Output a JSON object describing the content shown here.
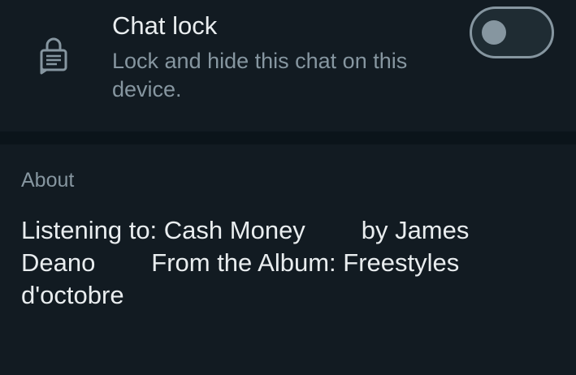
{
  "chat_lock": {
    "icon": "lock-chat-icon",
    "title": "Chat lock",
    "description": "Lock and hide this chat on this device.",
    "toggle_on": false
  },
  "about": {
    "heading": "About",
    "text": "Listening to: Cash Money        by James Deano        From the Album: Freestyles d'octobre"
  },
  "colors": {
    "background": "#121b22",
    "divider": "#0b141a",
    "primary_text": "#e9edef",
    "secondary_text": "#8696a0"
  }
}
